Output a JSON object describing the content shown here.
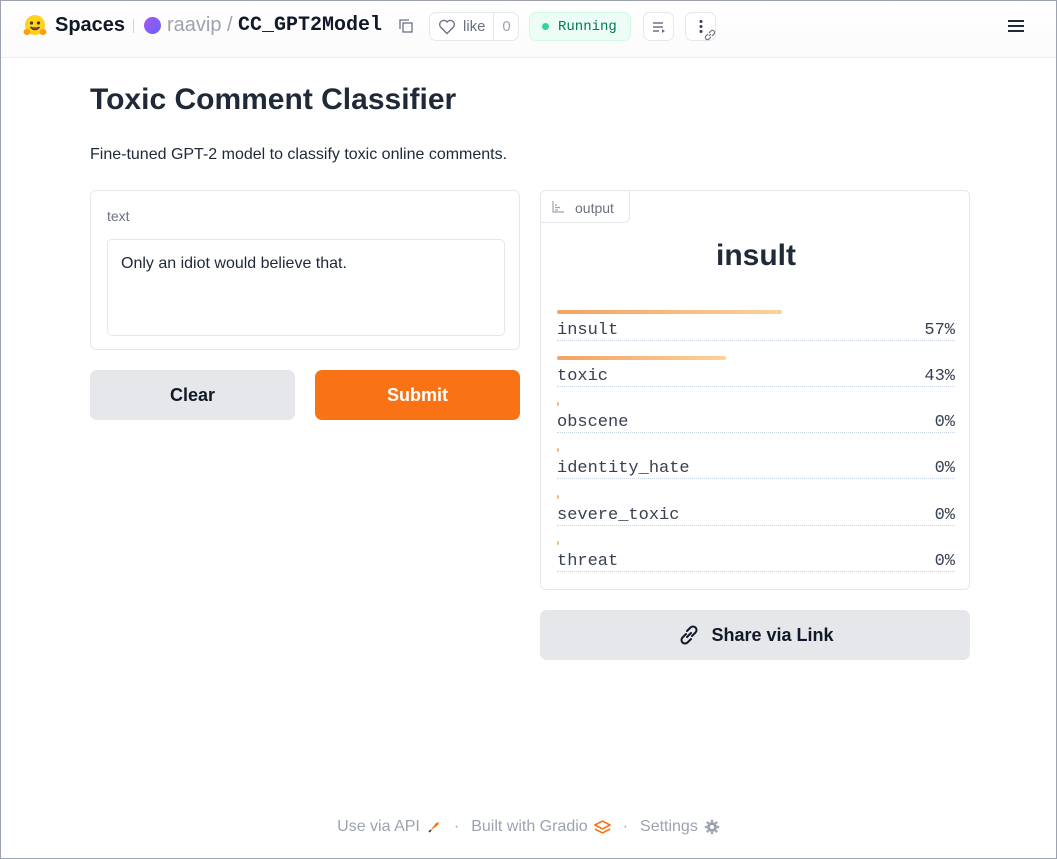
{
  "header": {
    "brand": "Spaces",
    "owner": "raavip",
    "slash": "/",
    "repo": "CC_GPT2Model",
    "like_label": "like",
    "like_count": "0",
    "status": "Running"
  },
  "app": {
    "title": "Toxic Comment Classifier",
    "description": "Fine-tuned GPT-2 model to classify toxic online comments."
  },
  "input": {
    "label": "text",
    "value": "Only an idiot would believe that."
  },
  "buttons": {
    "clear": "Clear",
    "submit": "Submit",
    "share": "Share via Link"
  },
  "output": {
    "tag": "output",
    "top_label": "insult",
    "confidences": [
      {
        "label": "insult",
        "value": "57%",
        "fraction": 0.57
      },
      {
        "label": "toxic",
        "value": "43%",
        "fraction": 0.43
      },
      {
        "label": "obscene",
        "value": "0%",
        "fraction": 0.0
      },
      {
        "label": "identity_hate",
        "value": "0%",
        "fraction": 0.0
      },
      {
        "label": "severe_toxic",
        "value": "0%",
        "fraction": 0.0
      },
      {
        "label": "threat",
        "value": "0%",
        "fraction": 0.0
      }
    ]
  },
  "footer": {
    "api": "Use via API",
    "built": "Built with Gradio",
    "settings": "Settings",
    "separator": "·"
  },
  "colors": {
    "accent": "#f97316",
    "running_text": "#047857",
    "running_bg": "#ecfdf5"
  },
  "icons": [
    "hugging-face-logo",
    "copy-icon",
    "heart-icon",
    "list-icon",
    "more-icon",
    "menu-icon",
    "chart-icon",
    "link-icon",
    "rocket-icon",
    "gradio-icon",
    "gear-icon"
  ]
}
